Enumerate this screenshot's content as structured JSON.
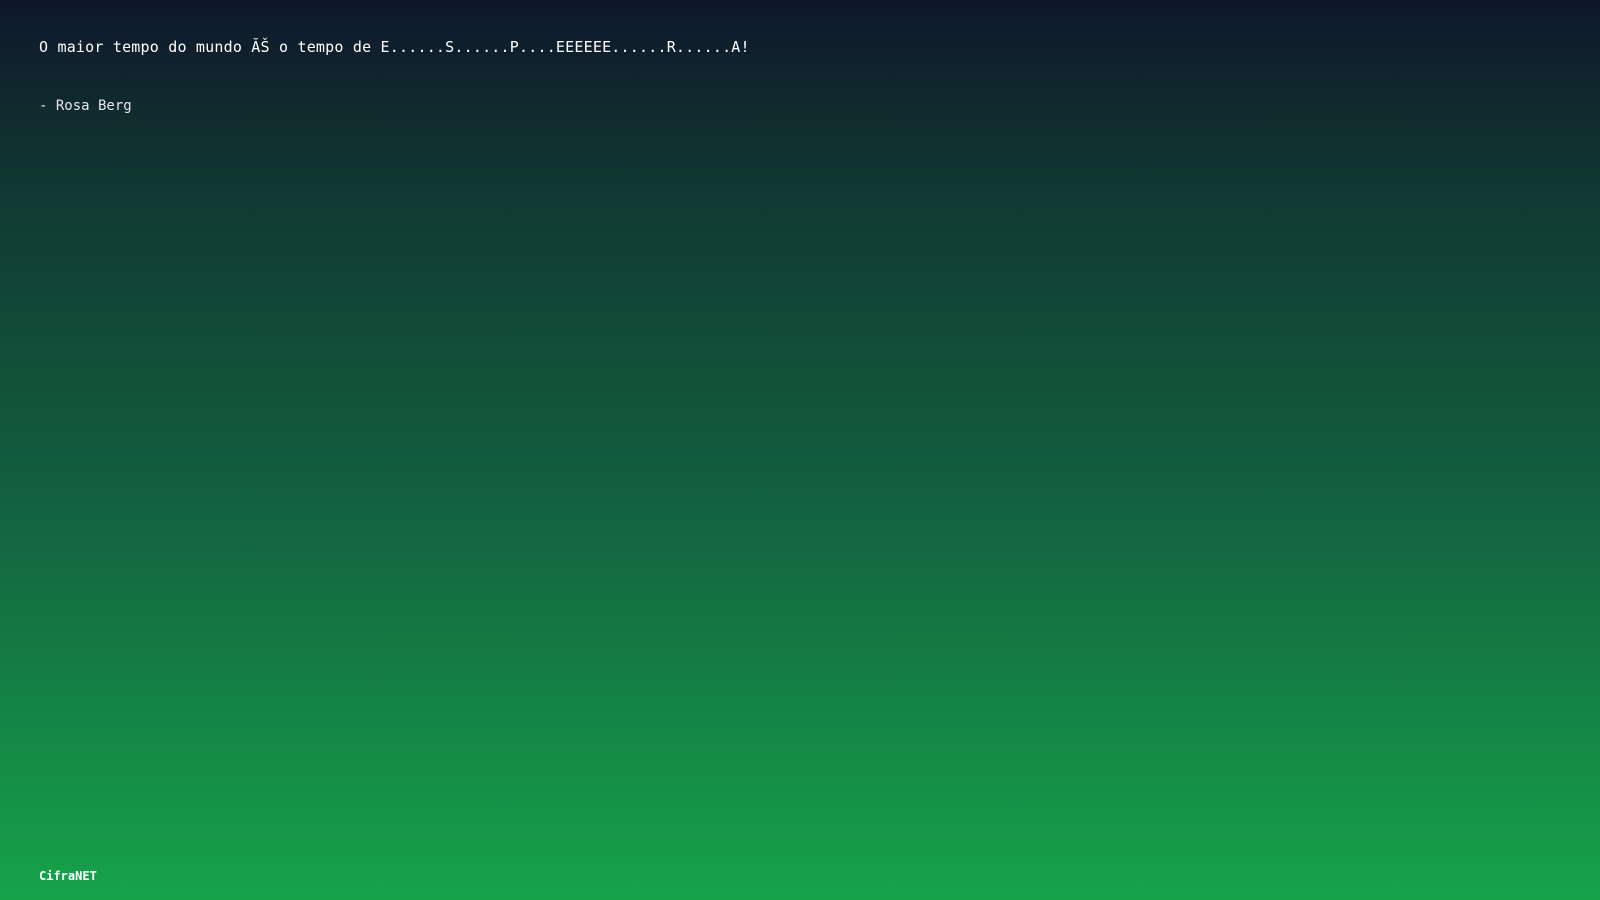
{
  "quote": {
    "text": "O maior tempo do mundo ĂŠ o tempo de E......S......P....EEEEEE......R......A!",
    "author": "- Rosa Berg"
  },
  "footer": {
    "brand": "CifraNET"
  },
  "colors": {
    "gradient_top": "#0f172a",
    "gradient_bottom": "#16a34a",
    "text": "#ffffff"
  }
}
